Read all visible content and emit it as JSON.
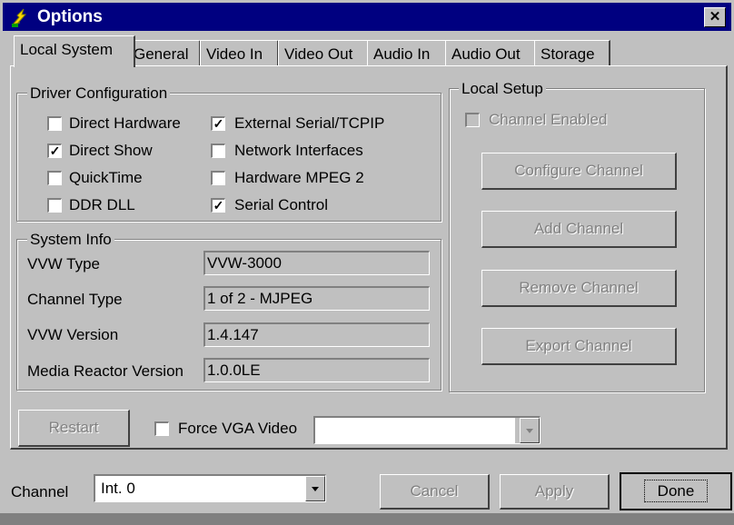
{
  "window": {
    "title": "Options",
    "close_label": "✕"
  },
  "tabs": [
    {
      "label": "Local System",
      "active": true
    },
    {
      "label": "General"
    },
    {
      "label": "Video In"
    },
    {
      "label": "Video Out"
    },
    {
      "label": "Audio In"
    },
    {
      "label": "Audio Out"
    },
    {
      "label": "Storage"
    }
  ],
  "driver_config": {
    "legend": "Driver Configuration",
    "options": [
      {
        "label": "Direct Hardware",
        "checked": false
      },
      {
        "label": "External Serial/TCPIP",
        "checked": true
      },
      {
        "label": "Direct Show",
        "checked": true
      },
      {
        "label": "Network Interfaces",
        "checked": false
      },
      {
        "label": "QuickTime",
        "checked": false
      },
      {
        "label": "Hardware MPEG 2",
        "checked": false
      },
      {
        "label": "DDR DLL",
        "checked": false
      },
      {
        "label": "Serial Control",
        "checked": true
      }
    ]
  },
  "system_info": {
    "legend": "System Info",
    "rows": [
      {
        "label": "VVW Type",
        "value": "VVW-3000"
      },
      {
        "label": "Channel Type",
        "value": "1 of 2 - MJPEG"
      },
      {
        "label": "VVW Version",
        "value": "1.4.147"
      },
      {
        "label": "Media Reactor Version",
        "value": "1.0.0LE"
      }
    ]
  },
  "local_setup": {
    "legend": "Local Setup",
    "channel_enabled_label": "Channel Enabled",
    "channel_enabled_checked": false,
    "buttons": [
      "Configure Channel",
      "Add Channel",
      "Remove Channel",
      "Export Channel"
    ]
  },
  "restart_label": "Restart",
  "force_vga": {
    "label": "Force VGA Video",
    "checked": false,
    "value": ""
  },
  "footer": {
    "channel_label": "Channel",
    "channel_value": "Int. 0",
    "cancel_label": "Cancel",
    "apply_label": "Apply",
    "done_label": "Done"
  },
  "icons": {
    "dropdown": "chevron-down-icon",
    "app": "app-icon",
    "close": "close-icon",
    "checkmark": "checkmark-icon"
  }
}
